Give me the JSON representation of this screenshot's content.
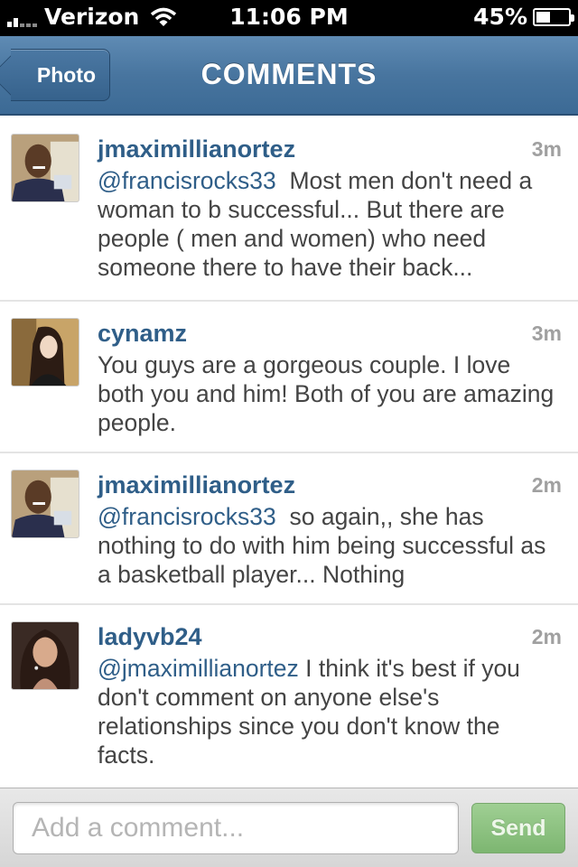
{
  "status_bar": {
    "carrier": "Verizon",
    "time": "11:06 PM",
    "battery": "45%",
    "battery_level": 0.45,
    "icons": [
      "signal-icon",
      "wifi-icon",
      "battery-icon"
    ]
  },
  "nav": {
    "back_label": "Photo",
    "title": "COMMENTS"
  },
  "comments": [
    {
      "username": "jmaximillianortez",
      "time": "3m",
      "mention": "@francisrocks33",
      "text": "Most men don't need a woman to b successful... But there are people ( men and women) who need someone there to have their back...",
      "avatar": "jmaximillianortez-avatar"
    },
    {
      "username": "cynamz",
      "time": "3m",
      "mention": "",
      "text": "You guys are a gorgeous couple. I love both you and him!  Both of you are amazing people.",
      "avatar": "cynamz-avatar"
    },
    {
      "username": "jmaximillianortez",
      "time": "2m",
      "mention": "@francisrocks33",
      "text": "so again,, she has nothing to do with him being successful as a basketball player... Nothing",
      "avatar": "jmaximillianortez-avatar"
    },
    {
      "username": "ladyvb24",
      "time": "2m",
      "mention": "@jmaximillianortez",
      "text": "I think it's best if you don't comment on anyone else's relationships since you don't know the facts.",
      "avatar": "ladyvb24-avatar"
    }
  ],
  "composer": {
    "placeholder": "Add a comment...",
    "value": "",
    "send_label": "Send"
  },
  "colors": {
    "nav_blue": "#48759f",
    "link_blue": "#2f5e88",
    "send_green": "#8cc27f"
  }
}
